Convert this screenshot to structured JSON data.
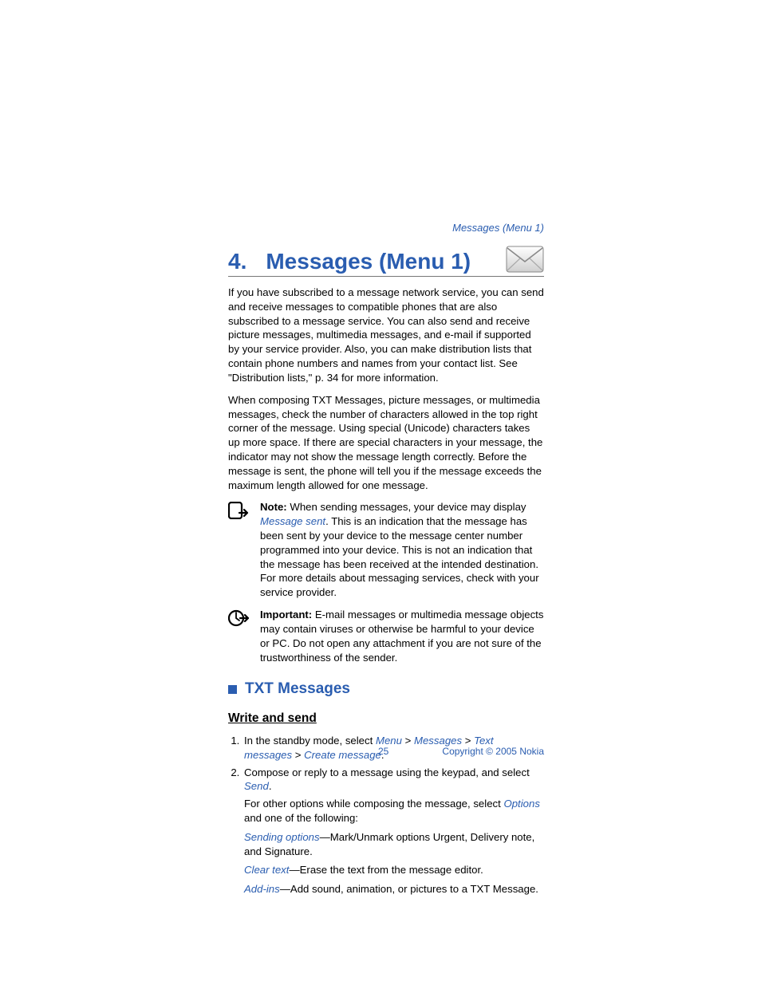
{
  "header_link": "Messages (Menu 1)",
  "chapter": {
    "num": "4.",
    "title": "Messages (Menu 1)"
  },
  "para1": "If you have subscribed to a message network service, you can send and receive messages to compatible phones that are also subscribed to a message service. You can also send and receive picture messages, multimedia messages, and e-mail if supported by your service provider. Also, you can make distribution lists that contain phone numbers and names from your contact list. See \"Distribution lists,\" p. 34 for more information.",
  "para2": "When composing TXT Messages, picture messages, or multimedia messages, check the number of characters allowed in the top right corner of the message. Using special (Unicode) characters takes up more space. If there are special characters in your message, the indicator may not show the message length correctly. Before the message is sent, the phone will tell you if the message exceeds the maximum length allowed for one message.",
  "note1": {
    "label": "Note:",
    "pre": " When sending messages, your device may display ",
    "link": "Message sent",
    "post": ". This is an indication that the message has been sent by your device to the message center number programmed into your device. This is not an indication that the message has been received at the intended destination. For more details about messaging services, check with your service provider."
  },
  "note2": {
    "label": "Important:",
    "text": " E-mail messages or multimedia message objects may contain viruses or otherwise be harmful to your device or PC. Do not open any attachment if you are not sure of the trustworthiness of the sender."
  },
  "section_title": "TXT Messages",
  "subsection_title": "Write and send",
  "steps": {
    "s1": {
      "pre": "In the standby mode, select ",
      "menu": "Menu",
      "sep": " > ",
      "messages": "Messages",
      "text_messages": "Text messages",
      "create": "Create message",
      "end": "."
    },
    "s2": {
      "line1_pre": "Compose or reply to a message using the keypad, and select ",
      "send": "Send",
      "line1_end": ".",
      "line2_pre": "For other options while composing the message, select ",
      "options": "Options",
      "line2_post": " and one of the following:",
      "opt1_link": "Sending options",
      "opt1_text": "—Mark/Unmark options Urgent, Delivery note, and Signature.",
      "opt2_link": "Clear text",
      "opt2_text": "—Erase the text from the message editor.",
      "opt3_link": "Add-ins",
      "opt3_text": "—Add sound, animation, or pictures to a TXT Message."
    }
  },
  "footer": {
    "page": "25",
    "copyright": "Copyright © 2005 Nokia"
  }
}
